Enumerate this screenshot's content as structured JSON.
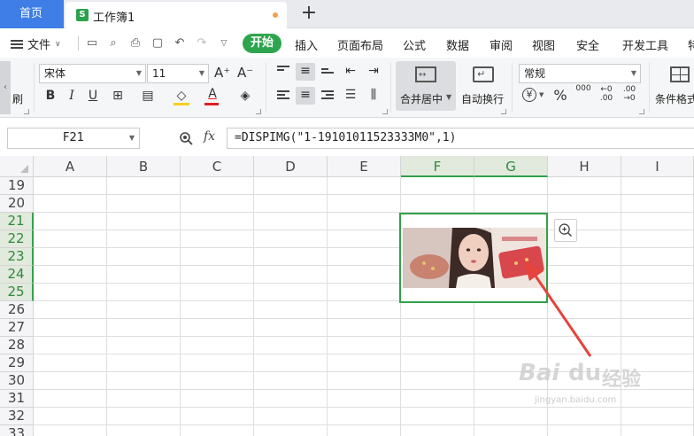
{
  "tabs": {
    "home": "首页",
    "doc_icon": "S",
    "doc_title": "工作簿1",
    "add": "+"
  },
  "menu": {
    "file": "文件",
    "items": [
      "开始",
      "插入",
      "页面布局",
      "公式",
      "数据",
      "审阅",
      "视图",
      "安全",
      "开发工具",
      "特"
    ]
  },
  "ribbon": {
    "brush_label": "刷",
    "font_name": "宋体",
    "font_size": "11",
    "grow_font": "A⁺",
    "shrink_font": "A⁻",
    "bold": "B",
    "italic": "I",
    "underline": "U",
    "merge_label": "合并居中",
    "wrap_label": "自动换行",
    "number_format": "常规",
    "currency": "¥",
    "percent": "%",
    "thousands": "000",
    "inc_decimal": ".00",
    "dec_decimal": ".00",
    "conditional_label": "条件格式"
  },
  "formula_bar": {
    "cell_ref": "F21",
    "fx": "fx",
    "formula": "=DISPIMG(\"1-19101011523333M0\",1)"
  },
  "grid": {
    "columns": [
      "A",
      "B",
      "C",
      "D",
      "E",
      "F",
      "G",
      "H",
      "I"
    ],
    "rows": [
      "19",
      "20",
      "21",
      "22",
      "23",
      "24",
      "25",
      "26",
      "27",
      "28",
      "29",
      "30",
      "31",
      "32",
      "33"
    ],
    "selected_columns": [
      "F",
      "G"
    ],
    "selected_rows": [
      "21",
      "22",
      "23",
      "24",
      "25"
    ]
  },
  "watermark": {
    "brand": "Bai",
    "brand2": "经验",
    "url": "jingyan.baidu.com"
  },
  "colors": {
    "accent_green": "#2ea44f",
    "tab_blue": "#3e7ee6",
    "selection": "#33a04a",
    "arrow": "#e5433b"
  }
}
